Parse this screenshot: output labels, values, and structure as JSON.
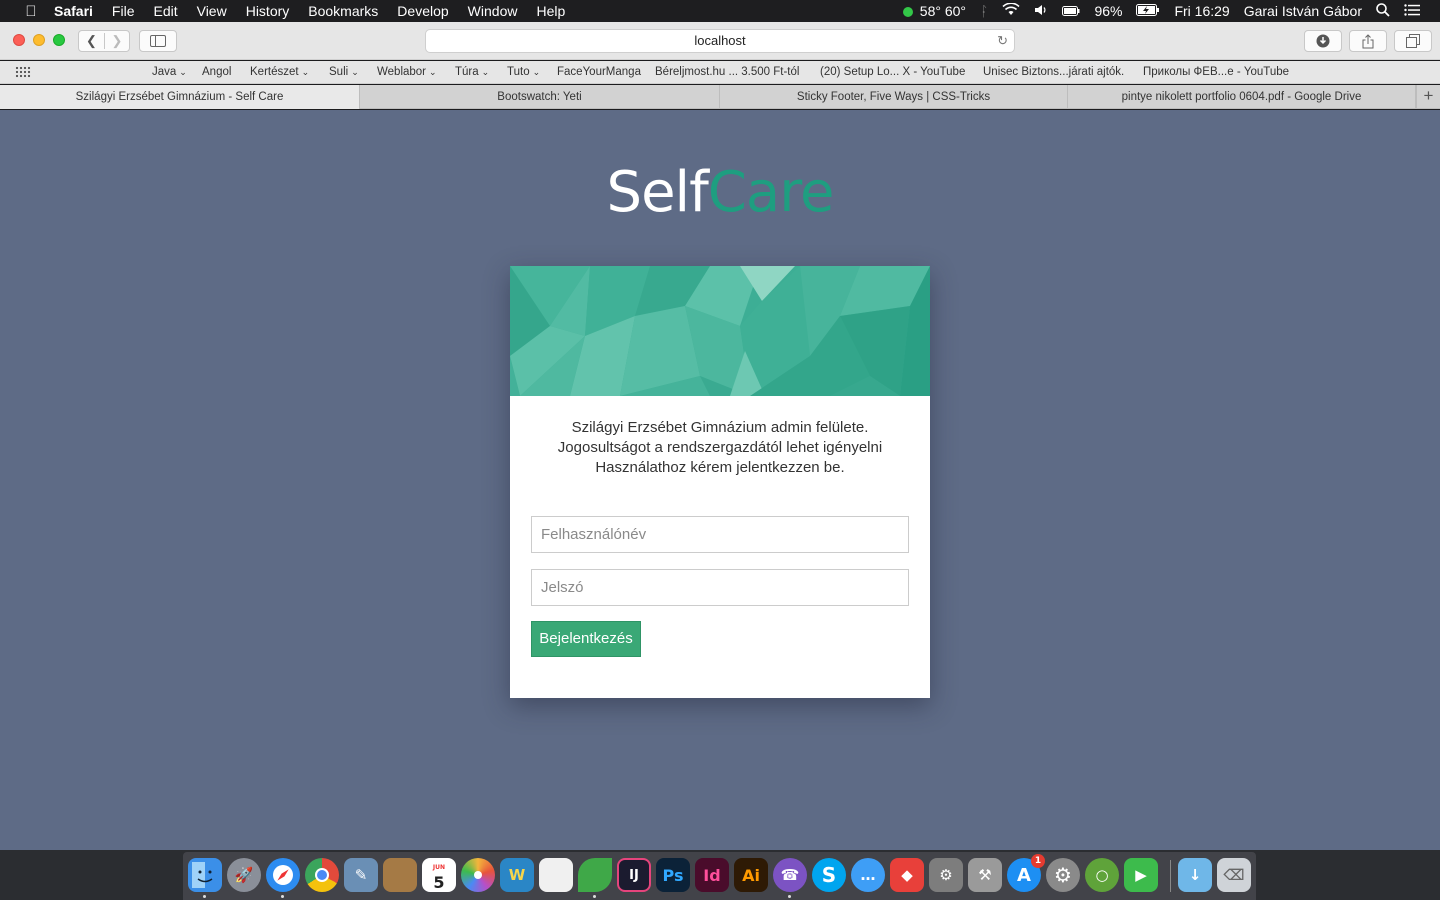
{
  "menubar": {
    "app_name": "Safari",
    "items": [
      "File",
      "Edit",
      "View",
      "History",
      "Bookmarks",
      "Develop",
      "Window",
      "Help"
    ],
    "weather": "58° 60°",
    "battery": "96%",
    "clock": "Fri 16:29",
    "user": "Garai István Gábor"
  },
  "toolbar": {
    "address": "localhost"
  },
  "bookmarks": [
    {
      "label": "Java",
      "folder": true
    },
    {
      "label": "Angol",
      "folder": false
    },
    {
      "label": "Kertészet",
      "folder": true
    },
    {
      "label": "Suli",
      "folder": true
    },
    {
      "label": "Weblabor",
      "folder": true
    },
    {
      "label": "Túra",
      "folder": true
    },
    {
      "label": "Tuto",
      "folder": true
    },
    {
      "label": "FaceYourManga",
      "folder": false
    },
    {
      "label": "Béreljmost.hu ... 3.500 Ft-tól",
      "folder": false
    },
    {
      "label": "(20) Setup Lo... X - YouTube",
      "folder": false
    },
    {
      "label": "Unisec Biztons...járati ajtók.",
      "folder": false
    },
    {
      "label": "Приколы ФЕВ...е - YouTube",
      "folder": false
    }
  ],
  "tabs": [
    {
      "title": "Szilágyi Erzsébet Gimnázium - Self Care",
      "active": true
    },
    {
      "title": "Bootswatch: Yeti",
      "active": false
    },
    {
      "title": "Sticky Footer, Five Ways | CSS-Tricks",
      "active": false
    },
    {
      "title": "pintye nikolett portfolio 0604.pdf - Google Drive",
      "active": false
    }
  ],
  "page": {
    "logo_part1": "Self",
    "logo_part2": "Care",
    "intro_line1": "Szilágyi Erzsébet Gimnázium admin felülete.",
    "intro_line2": "Jogosultságot a rendszergazdától lehet igényelni",
    "intro_line3": "Használathoz kérem jelentkezzen be.",
    "username_placeholder": "Felhasználónév",
    "password_placeholder": "Jelszó",
    "login_label": "Bejelentkezés"
  },
  "colors": {
    "page_bg": "#5e6b86",
    "accent_green": "#1e9e80",
    "button_green": "#3aa876"
  },
  "dock": {
    "calendar_day": "5",
    "calendar_month": "JUN",
    "appstore_badge": "1",
    "apps": [
      {
        "name": "finder-icon",
        "label": "",
        "color": "#3b8fe8"
      },
      {
        "name": "launchpad-icon",
        "label": "",
        "color": "#8a8f99"
      },
      {
        "name": "safari-icon",
        "label": "",
        "color": "#2d8cf0"
      },
      {
        "name": "chrome-icon",
        "label": "",
        "color": "#e24a3b"
      },
      {
        "name": "preview-icon",
        "label": "",
        "color": "#6a8fb5"
      },
      {
        "name": "notes-book-icon",
        "label": "",
        "color": "#a57a45"
      },
      {
        "name": "calendar-icon",
        "label": "",
        "color": "#ffffff"
      },
      {
        "name": "photos-icon",
        "label": "",
        "color": "#f3b53c"
      },
      {
        "name": "w-app-icon",
        "label": "W",
        "color": "#2a86c6"
      },
      {
        "name": "document-icon",
        "label": "",
        "color": "#f0f0f0"
      },
      {
        "name": "leaf-icon",
        "label": "",
        "color": "#3fa848"
      },
      {
        "name": "intellij-icon",
        "label": "IJ",
        "color": "#1b1b2f"
      },
      {
        "name": "photoshop-icon",
        "label": "Ps",
        "color": "#0b2238"
      },
      {
        "name": "indesign-icon",
        "label": "Id",
        "color": "#4a0c2b"
      },
      {
        "name": "illustrator-icon",
        "label": "Ai",
        "color": "#2e1a05"
      },
      {
        "name": "viber-icon",
        "label": "",
        "color": "#7c53c3"
      },
      {
        "name": "skype-icon",
        "label": "S",
        "color": "#00a5ef"
      },
      {
        "name": "messages-icon",
        "label": "",
        "color": "#3e9ef6"
      },
      {
        "name": "anydesk-icon",
        "label": "",
        "color": "#e8403a"
      },
      {
        "name": "utility-icon",
        "label": "",
        "color": "#7d7d7d"
      },
      {
        "name": "tool-icon",
        "label": "",
        "color": "#9a9a9a"
      },
      {
        "name": "appstore-icon",
        "label": "A",
        "color": "#1d8ff3"
      },
      {
        "name": "settings-icon",
        "label": "",
        "color": "#8a8a8a"
      },
      {
        "name": "chameleon-icon",
        "label": "",
        "color": "#5fa33a"
      },
      {
        "name": "facetime-icon",
        "label": "",
        "color": "#3dbb4c"
      },
      {
        "name": "downloads-folder-icon",
        "label": "",
        "color": "#6fb7e8"
      },
      {
        "name": "trash-icon",
        "label": "",
        "color": "#cfd3d8"
      }
    ]
  }
}
